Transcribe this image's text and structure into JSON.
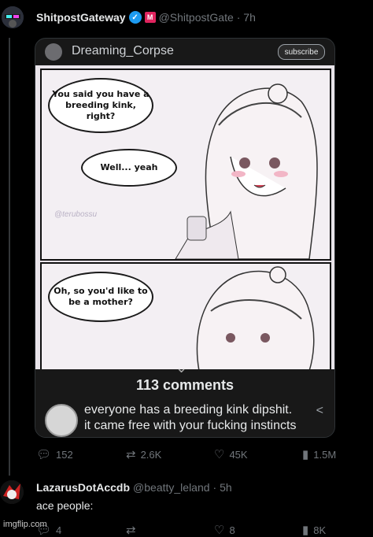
{
  "tweet": {
    "author_name": "ShitpostGateway",
    "author_handle": "@ShitpostGate",
    "time": "· 7h",
    "badge_label": "M",
    "stats": {
      "replies": "152",
      "retweets": "2.6K",
      "likes": "45K",
      "views": "1.5M"
    }
  },
  "embedded": {
    "channel": "Dreaming_Corpse",
    "subscribe": "subscribe",
    "comments_count": "113 comments",
    "comment_text": "everyone has a breeding kink dipshit. it came free with your fucking instincts",
    "comic": {
      "bubble1": "You said you have a breeding kink, right?",
      "bubble2": "Well... yeah",
      "bubble3": "Oh, so you'd like to be a mother?",
      "watermark": "@terubossu"
    }
  },
  "reply": {
    "author_name": "LazarusDotAccdb",
    "author_handle": "@beatty_leland",
    "time": "· 5h",
    "text": "ace people:",
    "stats": {
      "replies": "4",
      "likes": "8",
      "views": "8K"
    }
  },
  "footer": {
    "watermark": "imgflip.com"
  },
  "colors": {
    "background": "#000000",
    "accent": "#1d9bf0",
    "muted": "#71767b"
  }
}
